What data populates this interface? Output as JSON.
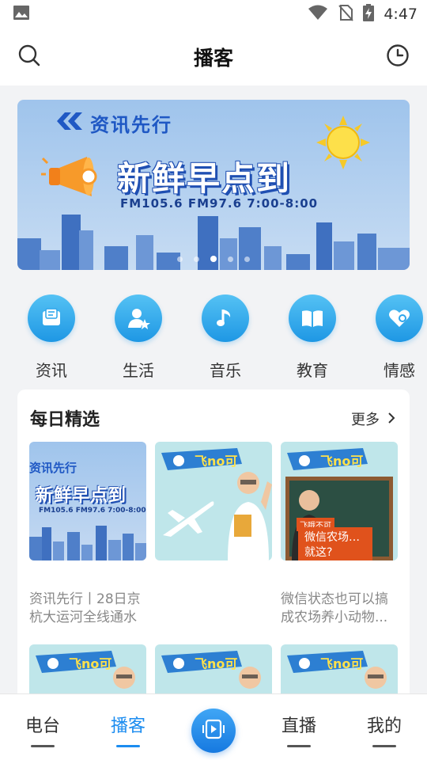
{
  "status_bar": {
    "time": "4:47",
    "icons": [
      "image-icon",
      "wifi-icon",
      "no-sim-icon",
      "battery-charging-icon"
    ]
  },
  "header": {
    "title": "播客",
    "left_icon": "search-icon",
    "right_icon": "history-clock-icon"
  },
  "banner": {
    "brand": "资讯先行",
    "title": "新鲜早点到",
    "subtitle": "FM105.6  FM97.6  7:00-8:00",
    "page_count": 5,
    "active_page": 3
  },
  "categories": [
    {
      "label": "资讯",
      "icon": "news-icon"
    },
    {
      "label": "生活",
      "icon": "life-person-star-icon"
    },
    {
      "label": "音乐",
      "icon": "music-note-icon"
    },
    {
      "label": "教育",
      "icon": "book-icon"
    },
    {
      "label": "情感",
      "icon": "heart-search-icon"
    }
  ],
  "daily": {
    "title": "每日精选",
    "more": "更多",
    "items": [
      {
        "caption": "资讯先行丨28日京杭大运河全线通水",
        "thumb_brand": "资讯先行",
        "thumb_title": "新鲜早点到",
        "thumb_sub": "FM105.6  FM97.6  7:00-8:00"
      },
      {
        "caption": ""
      },
      {
        "caption": "微信状态也可以搞成农场养小动物...",
        "thumb_tag": "飞哦不可",
        "thumb_caption": "微信农场…就这?"
      }
    ],
    "show_logo": "飞no可"
  },
  "bottom_nav": {
    "items": [
      {
        "label": "电台",
        "active": false
      },
      {
        "label": "播客",
        "active": true
      },
      {
        "label": "直播",
        "active": false
      },
      {
        "label": "我的",
        "active": false
      }
    ],
    "center_icon": "play-video-icon"
  }
}
